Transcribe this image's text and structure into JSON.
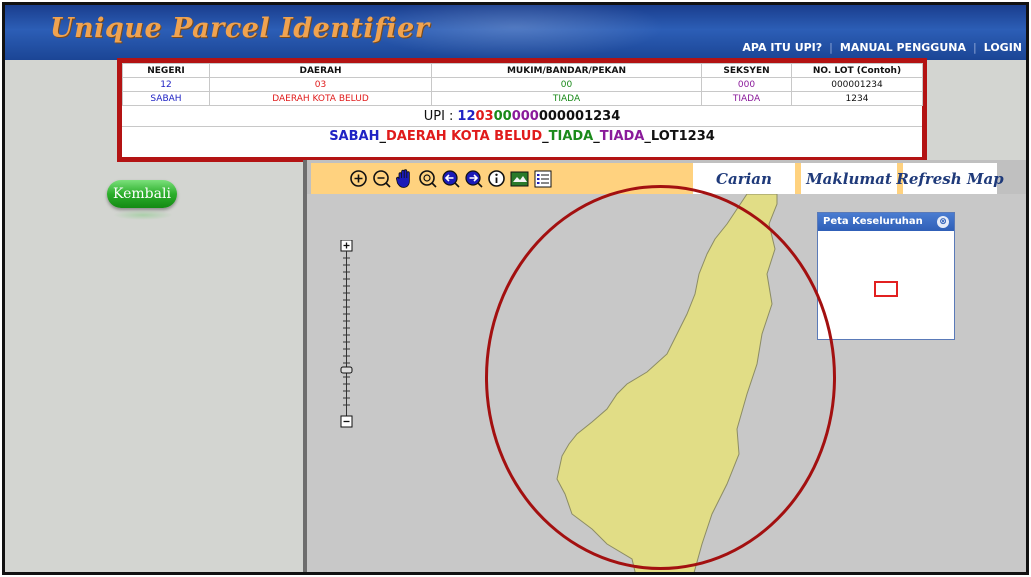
{
  "header": {
    "logo": "Unique Parcel Identifier",
    "nav": [
      "APA ITU UPI?",
      "MANUAL PENGGUNA",
      "LOGIN"
    ]
  },
  "info": {
    "columns": [
      "NEGERI",
      "DAERAH",
      "MUKIM/BANDAR/PEKAN",
      "SEKSYEN",
      "NO. LOT (Contoh)"
    ],
    "codes": [
      "12",
      "03",
      "00",
      "000",
      "000001234"
    ],
    "names": [
      "SABAH",
      "DAERAH KOTA BELUD",
      "TIADA",
      "TIADA",
      "1234"
    ],
    "upi_label": "UPI :",
    "upi_parts": [
      "12",
      "03",
      "00",
      "000",
      "000001234"
    ],
    "name_parts": [
      "SABAH",
      "_",
      "DAERAH KOTA BELUD",
      "_",
      "TIADA",
      "_",
      "TIADA",
      "_",
      "LOT1234"
    ],
    "colors": {
      "negeri": "#1f22c4",
      "daerah": "#e01b1b",
      "mukim": "#1a8a1a",
      "seksyen": "#8a1a9a",
      "lot": "#111111",
      "upi_negeri": "#1f22c4",
      "upi_daerah": "#e01b1b",
      "upi_mukim": "#1a8a1a",
      "upi_seksyen": "#8a1a9a"
    }
  },
  "kembali": "Kembali",
  "map": {
    "tabs": [
      "Carian",
      "Maklumat",
      "Refresh Map"
    ],
    "tools": [
      "zoom-in-icon",
      "zoom-out-icon",
      "pan-hand-icon",
      "zoom-extent-icon",
      "previous-extent-icon",
      "next-extent-icon",
      "identify-icon",
      "layer-icon",
      "legend-icon"
    ],
    "overview_title": "Peta Keseluruhan",
    "overview_close": "⊗",
    "zoom_plus": "+",
    "zoom_minus": "-"
  }
}
